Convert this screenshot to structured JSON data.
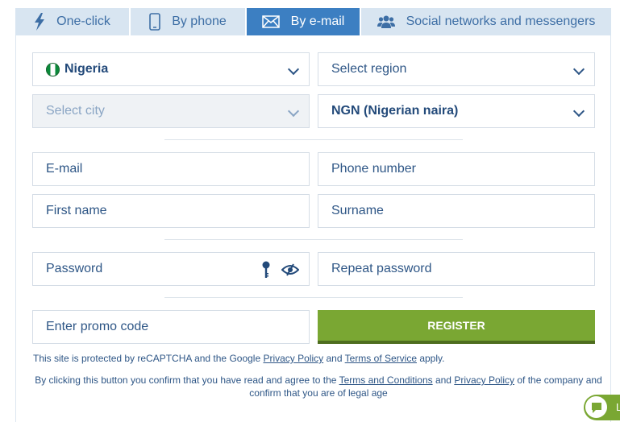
{
  "tabs": [
    {
      "label": "One-click",
      "icon": "lightning-icon",
      "active": false
    },
    {
      "label": "By phone",
      "icon": "mobile-phone-icon",
      "active": false
    },
    {
      "label": "By e-mail",
      "icon": "envelope-icon",
      "active": true
    },
    {
      "label": "Social networks and messengers",
      "icon": "users-icon",
      "active": false
    }
  ],
  "form": {
    "country": {
      "value": "Nigeria",
      "icon": "nigeria-flag-icon"
    },
    "region": {
      "placeholder": "Select region"
    },
    "city": {
      "placeholder": "Select city",
      "disabled": true
    },
    "currency": {
      "value": "NGN (Nigerian naira)"
    },
    "email": {
      "placeholder": "E-mail"
    },
    "phone": {
      "placeholder": "Phone number"
    },
    "first_name": {
      "placeholder": "First name"
    },
    "surname": {
      "placeholder": "Surname"
    },
    "password": {
      "placeholder": "Password"
    },
    "repeat_password": {
      "placeholder": "Repeat password"
    },
    "promo": {
      "placeholder": "Enter promo code"
    },
    "register_label": "REGISTER"
  },
  "recaptcha": {
    "text1": "This site is protected by reCAPTCHA and the Google ",
    "privacy_link": "Privacy Policy",
    "text2": " and ",
    "terms_link": "Terms of Service",
    "text3": " apply."
  },
  "agreement": {
    "text1": "By clicking this button you confirm that you have read and agree to the ",
    "terms_link": "Terms and Conditions",
    "text2": " and ",
    "privacy_link": "Privacy Policy",
    "text3": " of the company and confirm that you are of legal age"
  },
  "chat": {
    "label": "L"
  },
  "colors": {
    "accent": "#3c7fc2",
    "tab_bg": "#d8e5f1",
    "register": "#7aa733",
    "text": "#2e5686"
  }
}
